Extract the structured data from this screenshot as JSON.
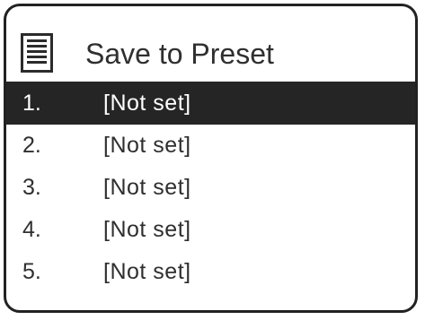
{
  "header": {
    "icon": "menu-list-icon",
    "title": "Save to Preset"
  },
  "presets": [
    {
      "number": "1.",
      "value": "[Not  set]",
      "selected": true
    },
    {
      "number": "2.",
      "value": "[Not  set]",
      "selected": false
    },
    {
      "number": "3.",
      "value": "[Not  set]",
      "selected": false
    },
    {
      "number": "4.",
      "value": "[Not  set]",
      "selected": false
    },
    {
      "number": "5.",
      "value": "[Not  set]",
      "selected": false
    }
  ],
  "colors": {
    "highlight_background": "#252525",
    "highlight_text": "#ffffff",
    "text": "#2f2f2f",
    "border": "#222222",
    "background": "#ffffff"
  }
}
